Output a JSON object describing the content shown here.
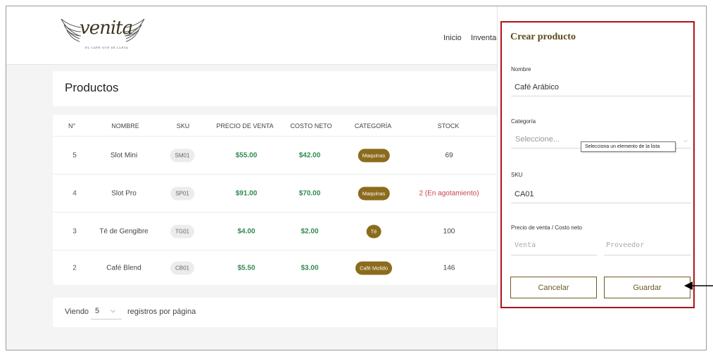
{
  "header": {
    "logo_text": "venita",
    "logo_tagline": "EL CAFÉ QUE SE LLEVA",
    "nav": [
      "Inicio",
      "Inventar"
    ]
  },
  "products": {
    "title": "Productos",
    "columns": [
      "N°",
      "NOMBRE",
      "SKU",
      "PRECIO DE VENTA",
      "COSTO NETO",
      "CATEGORÍA",
      "STOCK"
    ],
    "rows": [
      {
        "n": "5",
        "name": "Slot Mini",
        "sku": "SM01",
        "price": "$55.00",
        "cost": "$42.00",
        "category": "Maquinas",
        "stock": "69",
        "stock_alert": false
      },
      {
        "n": "4",
        "name": "Slot Pro",
        "sku": "SP01",
        "price": "$91.00",
        "cost": "$70.00",
        "category": "Maquinas",
        "stock": "2 (En agotamiento)",
        "stock_alert": true
      },
      {
        "n": "3",
        "name": "Té de Gengibre",
        "sku": "TG01",
        "price": "$4.00",
        "cost": "$2.00",
        "category": "Té",
        "stock": "100",
        "stock_alert": false
      },
      {
        "n": "2",
        "name": "Café Blend",
        "sku": "CB01",
        "price": "$5.50",
        "cost": "$3.00",
        "category": "Café Molido",
        "stock": "146",
        "stock_alert": false
      }
    ]
  },
  "pager": {
    "prefix": "Viendo",
    "per_page": "5",
    "suffix": "registros por página"
  },
  "form": {
    "title": "Crear producto",
    "name_label": "Nombre",
    "name_value": "Café Arábico",
    "category_label": "Categoría",
    "category_placeholder": "Seleccione...",
    "category_tooltip": "Selecciona un elemento de la lista",
    "sku_label": "SKU",
    "sku_value": "CA01",
    "price_label": "Precio de venta / Costo neto",
    "venta_placeholder": "Venta",
    "proveedor_placeholder": "Proveedor",
    "cancel_label": "Cancelar",
    "save_label": "Guardar"
  },
  "colors": {
    "accent": "#8b6b1c",
    "price_green": "#2f8a4f",
    "alert_red": "#c8434b",
    "highlight_border": "#b0121b"
  }
}
